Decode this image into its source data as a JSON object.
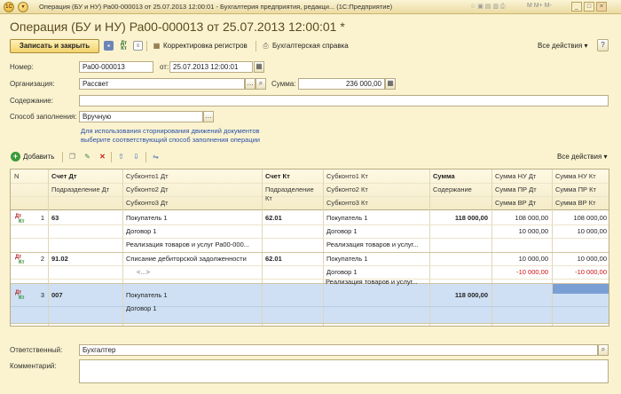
{
  "window": {
    "title": "Операция (БУ и НУ) Ра00-000013 от 25.07.2013 12:00:01 - Бухгалтерия предприятия, редакци... (1С:Предприятие)",
    "min": "_",
    "max": "□",
    "close": "×",
    "tools": "M  M+  M-"
  },
  "doc_title": "Операция (БУ и НУ) Ра00-000013 от 25.07.2013 12:00:01 *",
  "toolbar": {
    "save_close": "Записать и закрыть",
    "adjust_registers": "Корректировка регистров",
    "accounting_note": "Бухгалтерская справка",
    "all_actions": "Все действия ▾"
  },
  "form": {
    "number_label": "Номер:",
    "number": "Ра00-000013",
    "date_label": "от:",
    "date": "25.07.2013 12:00:01",
    "org_label": "Организация:",
    "org": "Рассвет",
    "sum_label": "Сумма:",
    "sum": "236 000,00",
    "content_label": "Содержание:",
    "content": "",
    "fill_label": "Способ заполнения:",
    "fill": "Вручную",
    "hint1": "Для использования сторнирования движений документов",
    "hint2": "выберите соответствующий способ заполнения операции",
    "responsible_label": "Ответственный:",
    "responsible": "Бухгалтер",
    "comment_label": "Комментарий:",
    "comment": ""
  },
  "table_toolbar": {
    "add": "Добавить",
    "all_actions": "Все действия ▾"
  },
  "table": {
    "headers": {
      "n": "N",
      "dt": "Счет Дт",
      "sub1dt": "Субконто1 Дт",
      "kt": "Счет Кт",
      "sub1kt": "Субконто1 Кт",
      "sum": "Сумма",
      "nu_dt": "Сумма НУ Дт",
      "nu_kt": "Сумма НУ Кт",
      "div_dt": "Подразделение Дт",
      "sub2dt": "Субконто2 Дт",
      "div_kt": "Подразделение Кт",
      "sub2kt": "Субконто2 Кт",
      "content": "Содержание",
      "pr_dt": "Сумма ПР Дт",
      "pr_kt": "Сумма ПР Кт",
      "sub3dt": "Субконто3 Дт",
      "sub3kt": "Субконто3 Кт",
      "vr_dt": "Сумма ВР Дт",
      "vr_kt": "Сумма ВР Кт"
    },
    "rows": [
      {
        "n": "1",
        "dt": "63",
        "kt": "62.01",
        "sub1dt": "Покупатель 1",
        "sub2dt": "Договор 1",
        "sub3dt": "Реализация товаров и услуг Ра00-000...",
        "sub1kt": "Покупатель 1",
        "sub2kt": "Договор 1",
        "sub3kt": "Реализация товаров и услуг...",
        "sum": "118 000,00",
        "nu_dt": "108 000,00",
        "pr_dt": "10 000,00",
        "vr_dt": "",
        "nu_kt": "108 000,00",
        "pr_kt": "10 000,00",
        "vr_kt": ""
      },
      {
        "n": "2",
        "dt": "91.02",
        "kt": "62.01",
        "sub1dt": "Списание дебиторской задолженности",
        "sub2dt": "<...>",
        "sub3dt": "",
        "sub1kt": "Покупатель 1",
        "sub2kt": "Договор 1",
        "sub3kt": "Реализация товаров и услуг...",
        "sum": "",
        "nu_dt": "10 000,00",
        "pr_dt": "-10 000,00",
        "vr_dt": "",
        "nu_kt": "10 000,00",
        "pr_kt": "-10 000,00",
        "vr_kt": ""
      },
      {
        "n": "3",
        "dt": "007",
        "kt": "",
        "sub1dt": "Покупатель 1",
        "sub2dt": "Договор 1",
        "sub3dt": "",
        "sub1kt": "",
        "sub2kt": "",
        "sub3kt": "",
        "sum": "118 000,00",
        "nu_dt": "",
        "pr_dt": "",
        "vr_dt": "",
        "nu_kt": "",
        "pr_kt": "",
        "vr_kt": ""
      }
    ],
    "ind_dt": "Дт",
    "ind_kt": "Кт"
  },
  "colors": {
    "bg": "#fbf3cf",
    "accent": "#f3d36a",
    "selection": "#cfe0f4",
    "negative": "#d01010",
    "hint": "#2850a8"
  }
}
